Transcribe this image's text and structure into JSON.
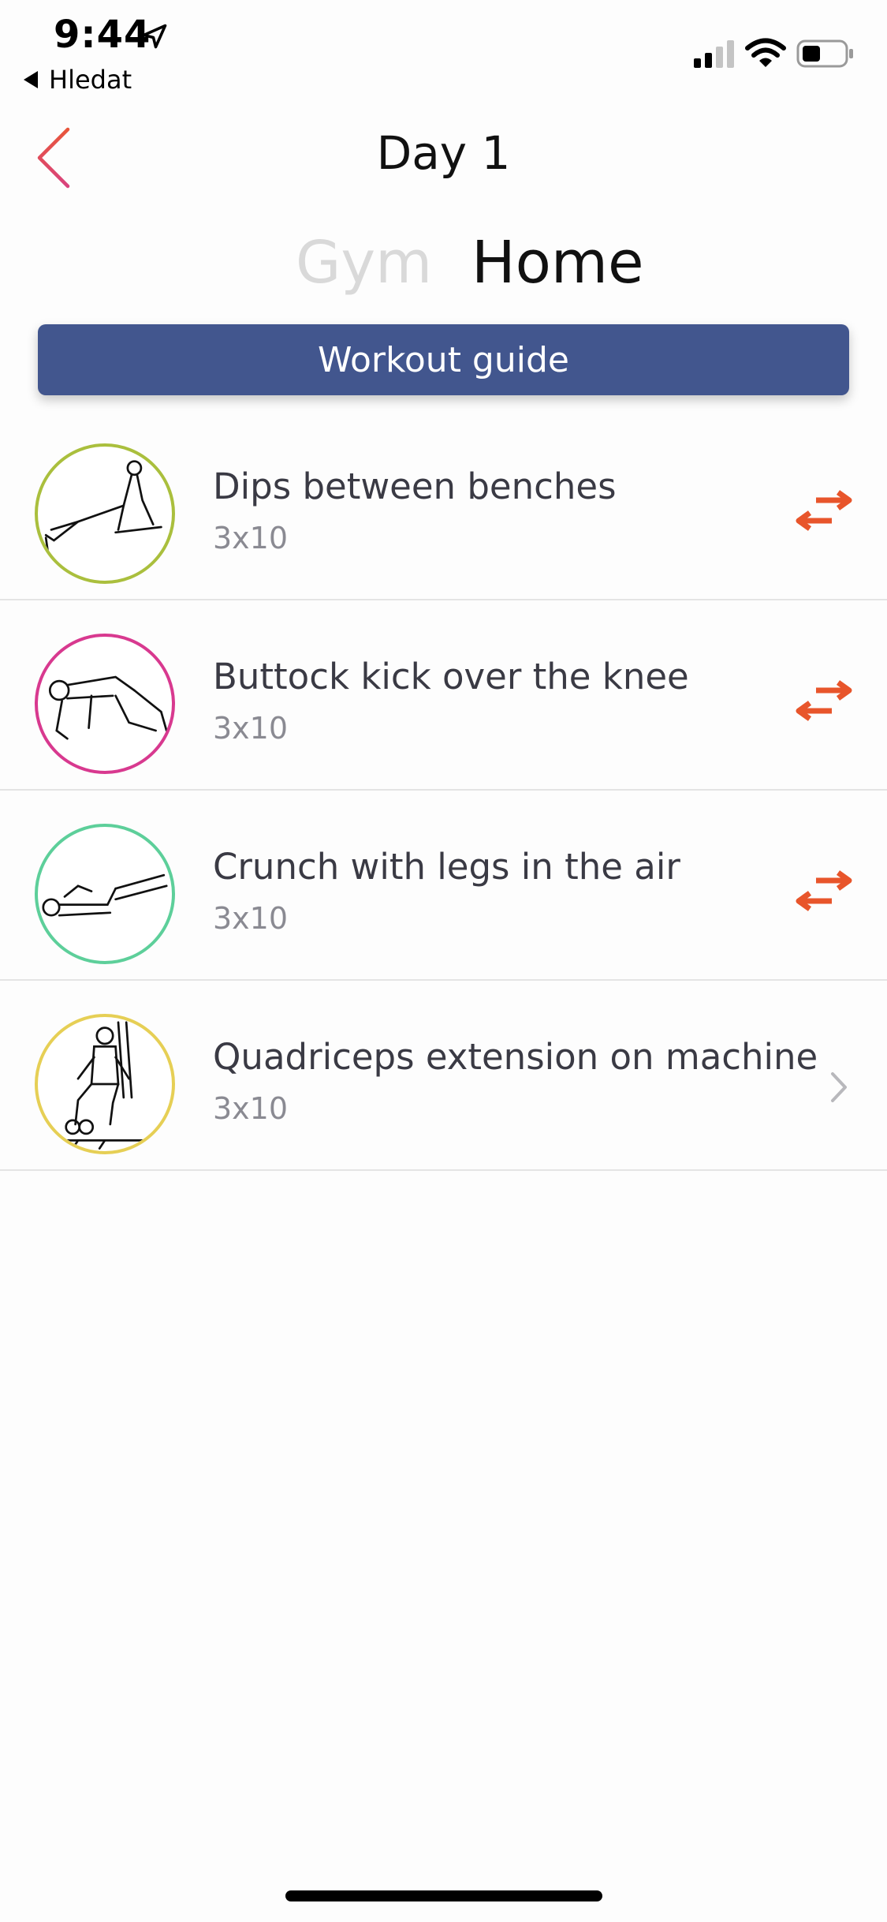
{
  "status_bar": {
    "time": "9:44",
    "back_label": "Hledat"
  },
  "nav": {
    "title": "Day 1"
  },
  "segment": {
    "gym": "Gym",
    "home": "Home",
    "selected": "Home"
  },
  "guide_button": "Workout guide",
  "colors": {
    "accent_orange": "#e8552b",
    "button_blue": "#42568e",
    "back_chevron": "#e25a6a"
  },
  "exercises": [
    {
      "name": "Dips between benches",
      "sets": "3x10",
      "ring": "#aabf3d",
      "action": "swap-icon"
    },
    {
      "name": "Buttock kick over the knee",
      "sets": "3x10",
      "ring": "#d8398f",
      "action": "swap-icon"
    },
    {
      "name": "Crunch with legs in the air",
      "sets": "3x10",
      "ring": "#5dcf9a",
      "action": "swap-icon"
    },
    {
      "name": "Quadriceps extension on machine",
      "sets": "3x10",
      "ring": "#e6cf55",
      "action": "chevron-right-icon"
    }
  ]
}
